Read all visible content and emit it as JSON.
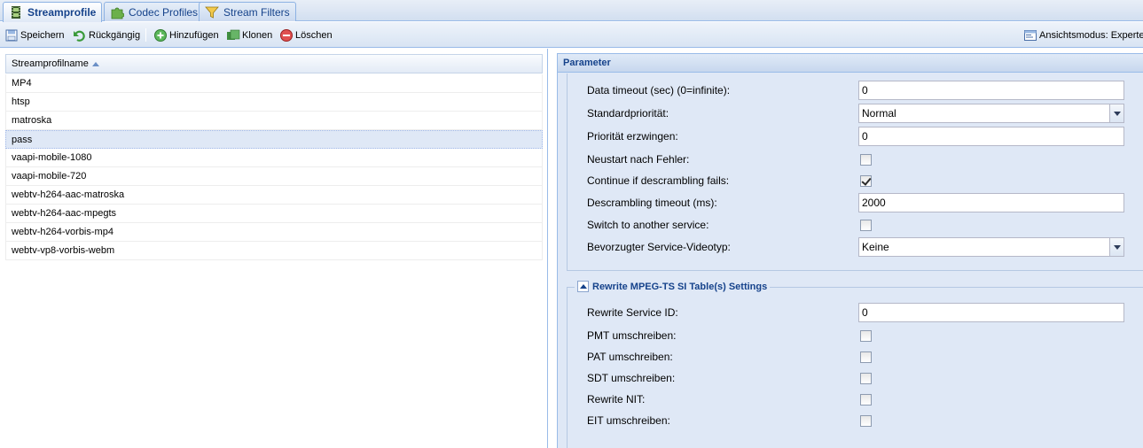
{
  "tabs": [
    {
      "label": "Streamprofile",
      "icon": "film-icon",
      "active": true
    },
    {
      "label": "Codec Profiles",
      "icon": "puzzle-icon",
      "active": false
    },
    {
      "label": "Stream Filters",
      "icon": "funnel-icon",
      "active": false
    }
  ],
  "toolbar": {
    "save": "Speichern",
    "undo": "Rückgängig",
    "add": "Hinzufügen",
    "clone": "Klonen",
    "delete": "Löschen",
    "view_mode": "Ansichtsmodus: Experte"
  },
  "grid": {
    "header": "Streamprofilname",
    "rows": [
      "MP4",
      "htsp",
      "matroska",
      "pass",
      "vaapi-mobile-1080",
      "vaapi-mobile-720",
      "webtv-h264-aac-matroska",
      "webtv-h264-aac-mpegts",
      "webtv-h264-vorbis-mp4",
      "webtv-vp8-vorbis-webm"
    ],
    "selected_index": 3
  },
  "panel": {
    "title": "Parameter",
    "fields": {
      "data_timeout": {
        "label": "Data timeout (sec) (0=infinite):",
        "value": "0"
      },
      "priority": {
        "label": "Standardpriorität:",
        "value": "Normal"
      },
      "force_priority": {
        "label": "Priorität erzwingen:",
        "value": "0"
      },
      "restart_on_error": {
        "label": "Neustart nach Fehler:",
        "checked": false
      },
      "continue_descrambling": {
        "label": "Continue if descrambling fails:",
        "checked": true
      },
      "descrambling_timeout": {
        "label": "Descrambling timeout (ms):",
        "value": "2000"
      },
      "switch_service": {
        "label": "Switch to another service:",
        "checked": false
      },
      "preferred_video": {
        "label": "Bevorzugter Service-Videotyp:",
        "value": "Keine"
      }
    },
    "rewrite_section": {
      "title": "Rewrite MPEG-TS SI Table(s) Settings",
      "service_id": {
        "label": "Rewrite Service ID:",
        "value": "0"
      },
      "pmt": {
        "label": "PMT umschreiben:",
        "checked": false
      },
      "pat": {
        "label": "PAT umschreiben:",
        "checked": false
      },
      "sdt": {
        "label": "SDT umschreiben:",
        "checked": false
      },
      "nit": {
        "label": "Rewrite NIT:",
        "checked": false
      },
      "eit": {
        "label": "EIT umschreiben:",
        "checked": false
      }
    }
  }
}
